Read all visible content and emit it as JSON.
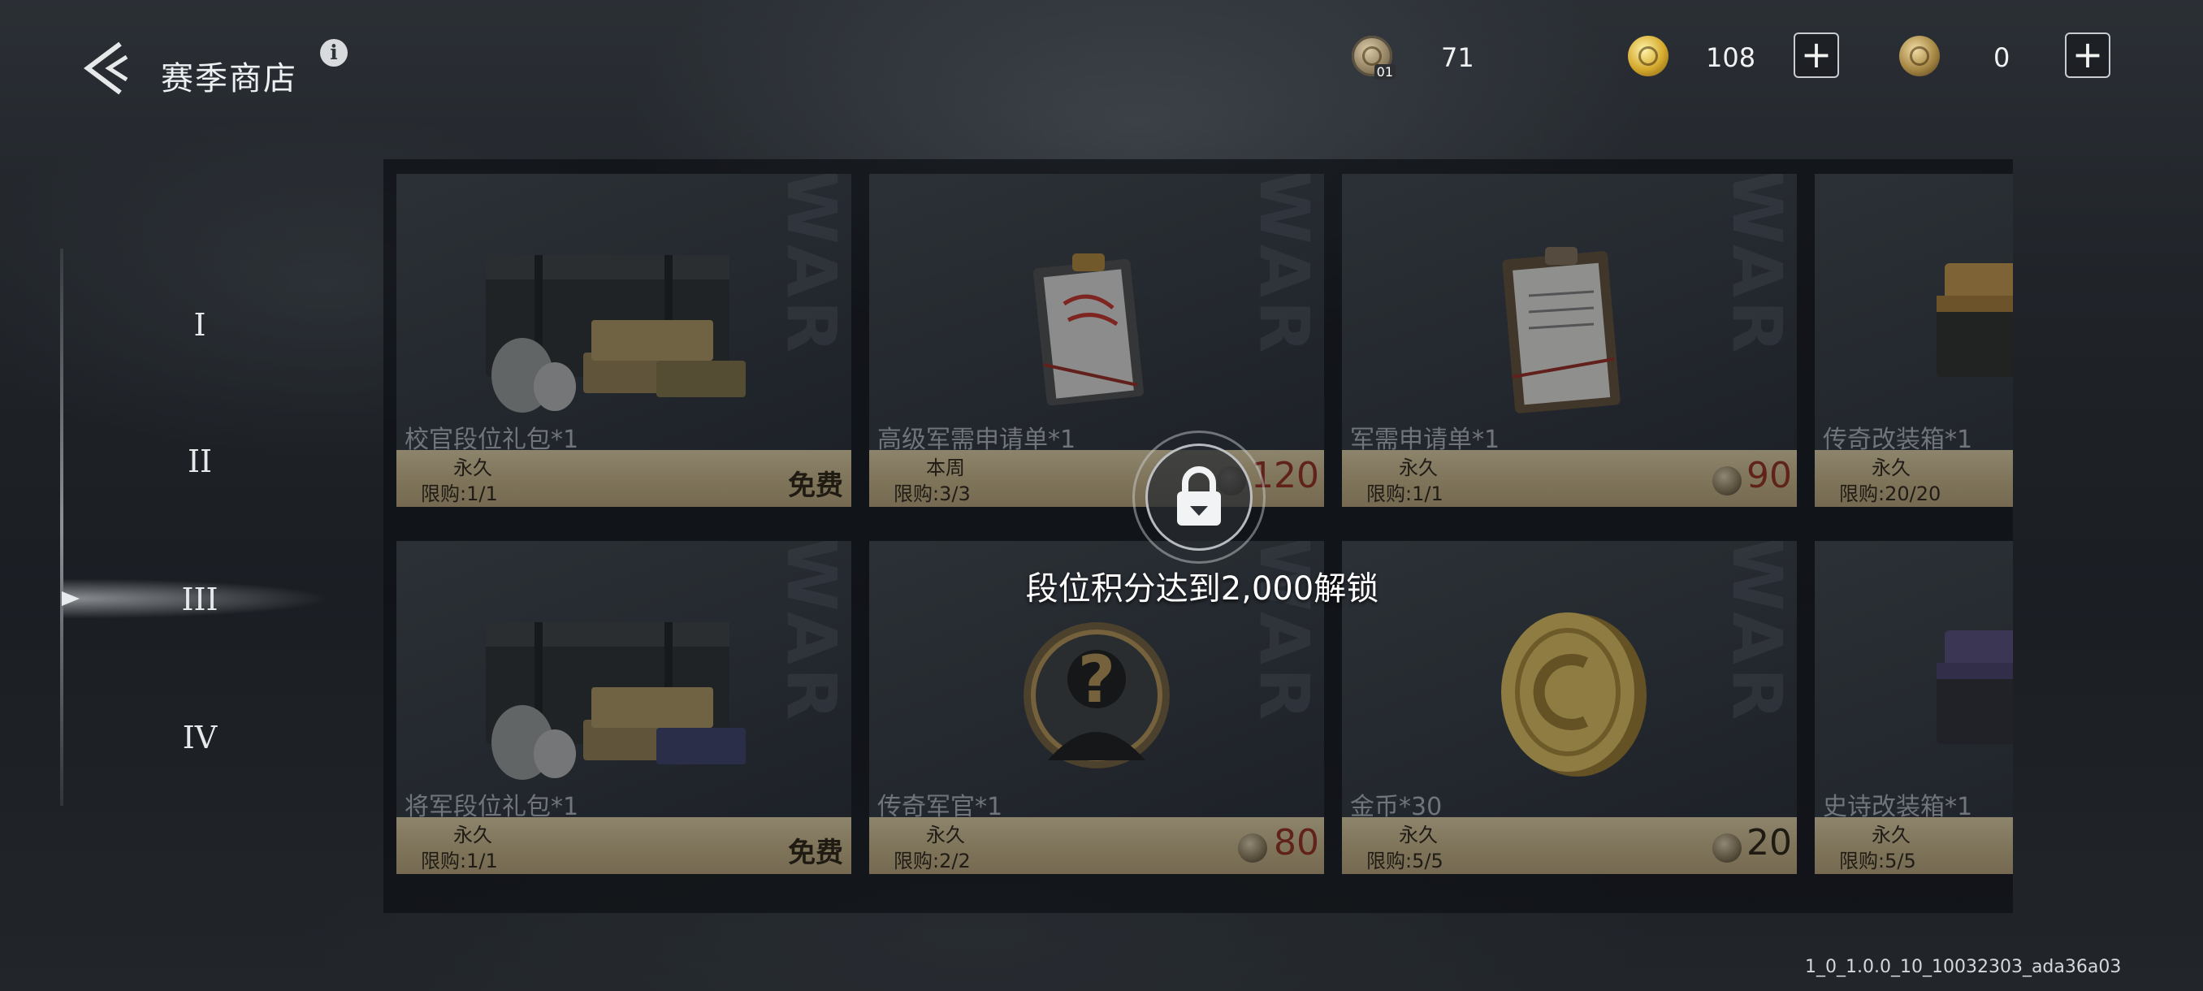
{
  "header": {
    "title": "赛季商店",
    "info_glyph": "i"
  },
  "currencies": [
    {
      "icon": "season-token-icon",
      "badge": "01",
      "value": "71",
      "has_plus": false
    },
    {
      "icon": "gold-coin-icon",
      "value": "108",
      "has_plus": true
    },
    {
      "icon": "c-coin-icon",
      "value": "0",
      "has_plus": true
    }
  ],
  "tiers": {
    "items": [
      "I",
      "II",
      "III",
      "IV"
    ],
    "selected": "III"
  },
  "items": [
    {
      "name": "校官段位礼包*1",
      "period": "永久",
      "limit": "限购:1/1",
      "price": "免费",
      "free": true,
      "icon": "crate-bundle-icon"
    },
    {
      "name": "高级军需申请单*1",
      "period": "本周",
      "limit": "限购:3/3",
      "price": "120",
      "free": false,
      "icon": "clipboard-red-icon"
    },
    {
      "name": "军需申请单*1",
      "period": "永久",
      "limit": "限购:1/1",
      "price": "90",
      "free": false,
      "icon": "clipboard-icon"
    },
    {
      "name": "传奇改装箱*1",
      "period": "永久",
      "limit": "限购:20/20",
      "price": "",
      "free": false,
      "icon": "gold-crate-icon"
    },
    {
      "name": "将军段位礼包*1",
      "period": "永久",
      "limit": "限购:1/1",
      "price": "免费",
      "free": true,
      "icon": "crate-bundle-icon"
    },
    {
      "name": "传奇军官*1",
      "period": "永久",
      "limit": "限购:2/2",
      "price": "80",
      "free": false,
      "icon": "mystery-officer-icon"
    },
    {
      "name": "金币*30",
      "period": "永久",
      "limit": "限购:5/5",
      "price": "20",
      "free": false,
      "icon": "gold-coin-icon"
    },
    {
      "name": "史诗改装箱*1",
      "period": "永久",
      "limit": "限购:5/5",
      "price": "",
      "free": false,
      "icon": "purple-crate-icon"
    }
  ],
  "watermark": "WAR",
  "lock": {
    "message": "段位积分达到2,000解锁",
    "icon": "lock-icon"
  },
  "build": "1_0_1.0.0_10_10032303_ada36a03",
  "colors": {
    "price_red": "#8a2d1f",
    "bar_tan": "#b7a67e",
    "text_light": "#e9eaec"
  }
}
